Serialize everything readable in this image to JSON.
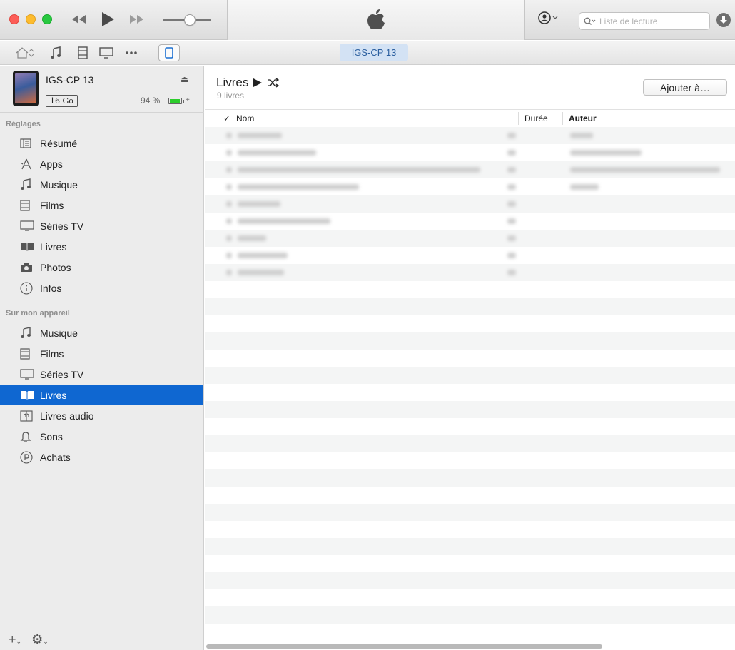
{
  "window": {
    "search": {
      "placeholder": "Liste de lecture"
    },
    "device_pill": "IGS-CP 13"
  },
  "device": {
    "name": "IGS-CP 13",
    "capacity": "16 Go",
    "battery_pct": "94 %",
    "battery_level": 0.94
  },
  "sidebar": {
    "settings_title": "Réglages",
    "settings_items": [
      {
        "label": "Résumé",
        "icon": "summary-icon"
      },
      {
        "label": "Apps",
        "icon": "apps-icon"
      },
      {
        "label": "Musique",
        "icon": "music-icon"
      },
      {
        "label": "Films",
        "icon": "film-icon"
      },
      {
        "label": "Séries TV",
        "icon": "tv-icon"
      },
      {
        "label": "Livres",
        "icon": "book-icon"
      },
      {
        "label": "Photos",
        "icon": "camera-icon"
      },
      {
        "label": "Infos",
        "icon": "info-icon"
      }
    ],
    "device_title": "Sur mon appareil",
    "device_items": [
      {
        "label": "Musique",
        "icon": "music-icon"
      },
      {
        "label": "Films",
        "icon": "film-icon"
      },
      {
        "label": "Séries TV",
        "icon": "tv-icon"
      },
      {
        "label": "Livres",
        "icon": "book-icon",
        "active": true
      },
      {
        "label": "Livres audio",
        "icon": "audiobook-icon"
      },
      {
        "label": "Sons",
        "icon": "bell-icon"
      },
      {
        "label": "Achats",
        "icon": "purchases-icon"
      }
    ]
  },
  "content": {
    "title": "Livres",
    "count": "9 livres",
    "add_button": "Ajouter à…",
    "columns": {
      "check": "✓",
      "name": "Nom",
      "duration": "Durée",
      "author": "Auteur"
    },
    "row_count": 9
  },
  "colors": {
    "accent": "#0f67d1",
    "pill": "#d3e2f4"
  }
}
